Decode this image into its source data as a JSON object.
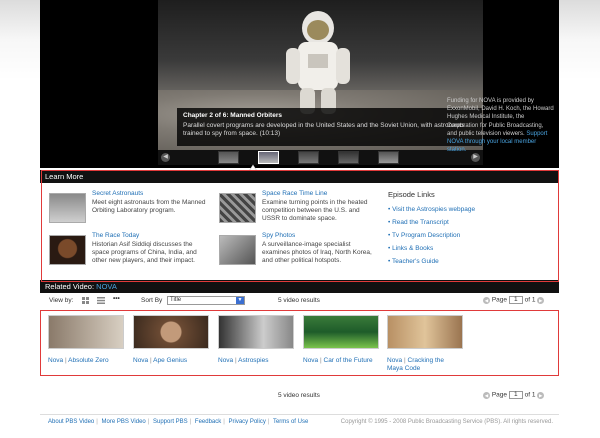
{
  "player": {
    "chapter_title": "Chapter 2 of 6: Manned Orbiters",
    "chapter_desc": "Parallel covert programs are developed in the United States and the Soviet Union, with astronauts trained to spy from space. (10:13)",
    "funding_text": "Funding for NOVA is provided by ExxonMobil, David H. Koch, the Howard Hughes Medical Institute, the Corporation for Public Broadcasting, and public television viewers.",
    "support_link": "Support NOVA through your local member station."
  },
  "learn_more": {
    "header": "Learn More",
    "items": [
      {
        "title": "Secret Astronauts",
        "desc": "Meet eight astronauts from the Manned Orbiting Laboratory program."
      },
      {
        "title": "Space Race Time Line",
        "desc": "Examine turning points in the heated competition between the U.S. and USSR to dominate space."
      },
      {
        "title": "The Race Today",
        "desc": "Historian Asif Siddiqi discusses the space programs of China, India, and other new players, and their impact."
      },
      {
        "title": "Spy Photos",
        "desc": "A surveillance-image specialist examines photos of Iraq, North Korea, and other political hotspots."
      }
    ],
    "episode_links_header": "Episode Links",
    "episode_links": [
      "• Visit the Astrospies webpage",
      "• Read the Transcript",
      "• Tv Program Description",
      "• Links & Books",
      "• Teacher's Guide"
    ]
  },
  "related": {
    "header_prefix": "Related Video: ",
    "header_series": "NOVA",
    "view_by_label": "View by:",
    "sort_by_label": "Sort By",
    "sort_value": "Title",
    "results": "5 video results",
    "page_label": "Page",
    "page_value": "1",
    "page_of": "of 1",
    "videos": [
      {
        "series": "Nova",
        "sep": " | ",
        "title": "Absolute Zero"
      },
      {
        "series": "Nova",
        "sep": " | ",
        "title": "Ape Genius"
      },
      {
        "series": "Nova",
        "sep": " | ",
        "title": "Astrospies"
      },
      {
        "series": "Nova",
        "sep": " | ",
        "title": "Car of the Future"
      },
      {
        "series": "Nova",
        "sep": " | ",
        "title": "Cracking the Maya Code"
      }
    ]
  },
  "footer": {
    "links": [
      "About PBS Video",
      "More PBS Video",
      "Support PBS",
      "Feedback",
      "Privacy Policy",
      "Terms of Use"
    ],
    "copyright": "Copyright © 1995 - 2008 Public Broadcasting Service (PBS). All rights reserved."
  },
  "colors": {
    "link": "#1f6fb5",
    "header_bg": "#111111",
    "highlight": "#e03a3a"
  }
}
